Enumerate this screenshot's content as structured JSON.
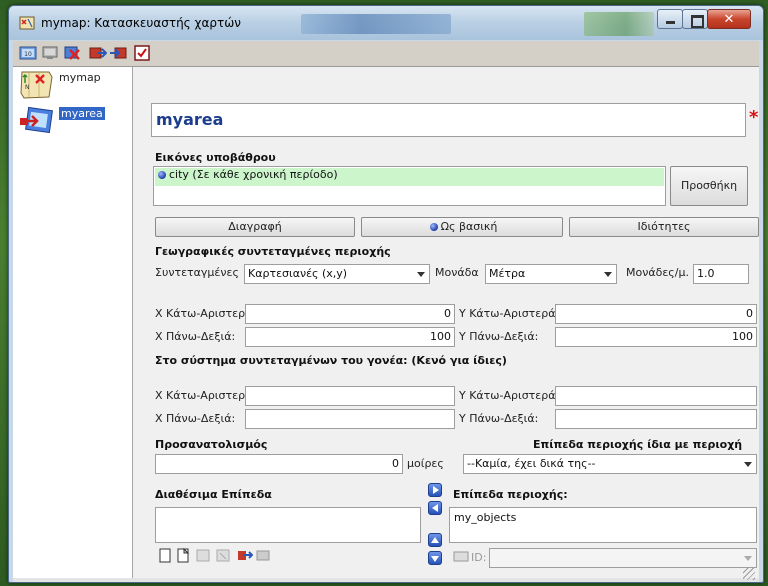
{
  "window": {
    "title": "mymap: Κατασκευαστής χαρτών"
  },
  "toolbar": {
    "buttons": [
      "zoom-icon",
      "screen-icon",
      "delete-map-icon",
      "export-icon",
      "import-icon",
      "checkbox-icon"
    ]
  },
  "tree": {
    "items": [
      {
        "label": "mymap",
        "icon": "map-icon"
      },
      {
        "label": "myarea",
        "icon": "area-icon",
        "selected": true
      }
    ]
  },
  "area": {
    "name": "myarea",
    "required_marker": "*"
  },
  "background_images": {
    "heading": "Εικόνες υποβάθρου",
    "items": [
      "city (Σε κάθε χρονική περίοδο)"
    ],
    "add_button": "Προσθήκη",
    "delete_button": "Διαγραφή",
    "as_base_button": "Ως βασική",
    "properties_button": "Ιδιότητες"
  },
  "geo_coords": {
    "heading": "Γεωγραφικές συντεταγμένες περιοχής",
    "coords_label": "Συντεταγμένες",
    "coords_value": "Καρτεσιανές (x,y)",
    "unit_label": "Μονάδα",
    "unit_value": "Μέτρα",
    "units_per_label": "Μονάδες/μ.",
    "units_per_value": "1.0",
    "x_bl_label": "X Κάτω-Αριστερά:",
    "x_bl_value": "0",
    "y_bl_label": "Y Κάτω-Αριστερά:",
    "y_bl_value": "0",
    "x_tr_label": "X Πάνω-Δεξιά:",
    "x_tr_value": "100",
    "y_tr_label": "Y Πάνω-Δεξιά:",
    "y_tr_value": "100"
  },
  "parent_coords": {
    "heading": "Στο σύστημα συντεταγμένων του γονέα: (Κενό για ίδιες)",
    "x_bl_label": "X Κάτω-Αριστερά:",
    "y_bl_label": "Y Κάτω-Αριστερά:",
    "x_tr_label": "X Πάνω-Δεξιά:",
    "y_tr_label": "Y Πάνω-Δεξιά:",
    "x_bl_value": "",
    "y_bl_value": "",
    "x_tr_value": "",
    "y_tr_value": ""
  },
  "orientation": {
    "heading": "Προσανατολισμός",
    "value": "0",
    "unit": "μοίρες"
  },
  "layers_same": {
    "heading": "Επίπεδα περιοχής ίδια με περιοχή",
    "value": "--Καμία, έχει δικά της--"
  },
  "available_layers": {
    "heading": "Διαθέσιμα Επίπεδα",
    "items": []
  },
  "area_layers": {
    "heading": "Επίπεδα περιοχής:",
    "items": [
      "my_objects"
    ],
    "id_label": "ID:",
    "id_value": ""
  }
}
